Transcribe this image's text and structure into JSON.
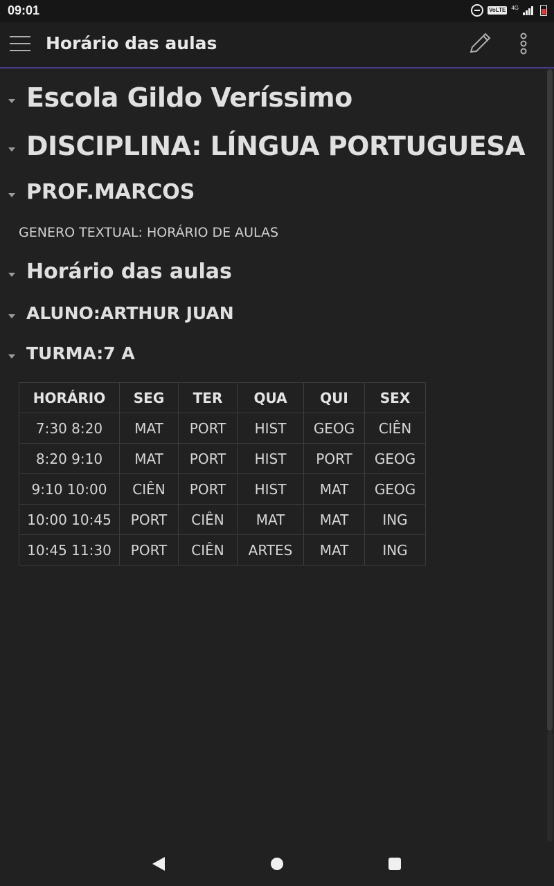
{
  "status_bar": {
    "time": "09:01",
    "volte": "VoLTE",
    "network": "4G"
  },
  "app_bar": {
    "title": "Horário das aulas"
  },
  "document": {
    "school": "Escola Gildo Veríssimo",
    "subject": "DISCIPLINA: LÍNGUA PORTUGUESA",
    "teacher": "PROF.MARCOS",
    "genre": "GENERO TEXTUAL: HORÁRIO DE AULAS",
    "section_title": "Horário das aulas",
    "student": "ALUNO:ARTHUR JUAN",
    "class": "TURMA:7 A"
  },
  "table": {
    "headers": [
      "HORÁRIO",
      "SEG",
      "TER",
      "QUA",
      "QUI",
      "SEX"
    ],
    "rows": [
      [
        "7:30 8:20",
        "MAT",
        "PORT",
        "HIST",
        "GEOG",
        "CIÊN"
      ],
      [
        "8:20 9:10",
        "MAT",
        "PORT",
        "HIST",
        "PORT",
        "GEOG"
      ],
      [
        "9:10 10:00",
        "CIÊN",
        "PORT",
        "HIST",
        "MAT",
        "GEOG"
      ],
      [
        "10:00 10:45",
        "PORT",
        "CIÊN",
        "MAT",
        "MAT",
        "ING"
      ],
      [
        "10:45 11:30",
        "PORT",
        "CIÊN",
        "ARTES",
        "MAT",
        "ING"
      ]
    ]
  },
  "icons": {
    "menu": "hamburger-icon",
    "edit": "pencil-icon",
    "more": "vertical-dots-icon",
    "fold": "triangle-down-icon"
  }
}
